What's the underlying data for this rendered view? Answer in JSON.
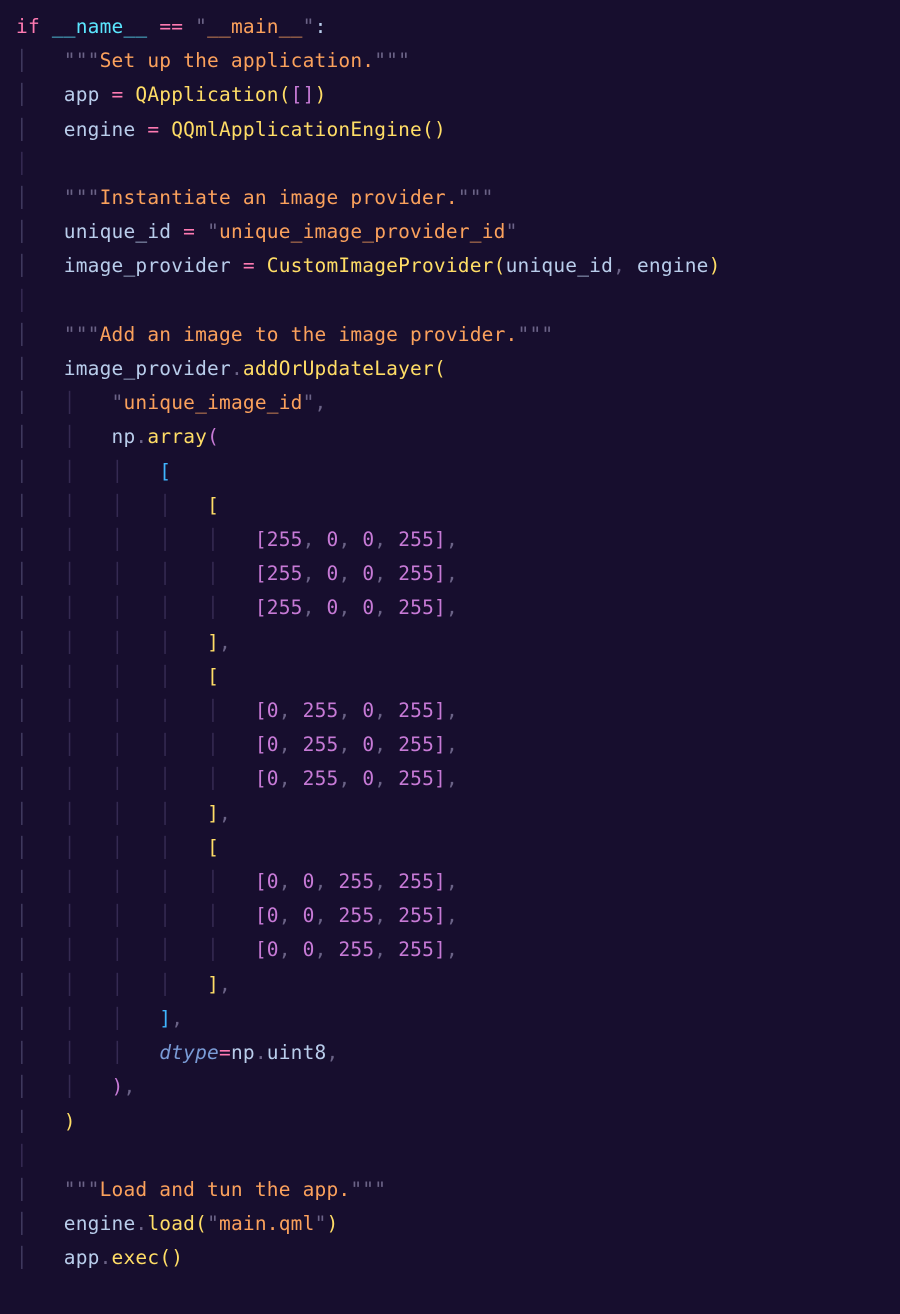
{
  "code": {
    "l1": {
      "if": "if",
      "sp": " ",
      "name": "__name__",
      "eq": " == ",
      "q": "\"",
      "main": "__main__",
      "colon": ":"
    },
    "l2": {
      "q": "\"\"\"",
      "txt": "Set up the application."
    },
    "l3": {
      "app": "app",
      "eq": " = ",
      "fn": "QApplication",
      "lp": "(",
      "lb": "[",
      "rb": "]",
      "rp": ")"
    },
    "l4": {
      "engine": "engine",
      "eq": " = ",
      "fn": "QQmlApplicationEngine",
      "lp": "(",
      "rp": ")"
    },
    "l5": {
      "q": "\"\"\"",
      "txt": "Instantiate an image provider."
    },
    "l6": {
      "uid": "unique_id",
      "eq": " = ",
      "q": "\"",
      "val": "unique_image_provider_id"
    },
    "l7": {
      "ip": "image_provider",
      "eq": " = ",
      "fn": "CustomImageProvider",
      "lp": "(",
      "a1": "unique_id",
      "c": ", ",
      "a2": "engine",
      "rp": ")"
    },
    "l8": {
      "q": "\"\"\"",
      "txt": "Add an image to the image provider."
    },
    "l9": {
      "ip": "image_provider",
      "dot": ".",
      "fn": "addOrUpdateLayer",
      "lp": "("
    },
    "l10": {
      "q": "\"",
      "val": "unique_image_id",
      "c": ","
    },
    "l11": {
      "np": "np",
      "dot": ".",
      "fn": "array",
      "lp": "("
    },
    "l12": {
      "lb": "["
    },
    "l13": {
      "lb": "["
    },
    "row_red": {
      "lb": "[",
      "a": "255",
      "b": "0",
      "c2": "0",
      "d": "255",
      "rb": "]",
      "tc": ","
    },
    "l17": {
      "rb": "]",
      "c": ","
    },
    "l18": {
      "lb": "["
    },
    "row_green": {
      "lb": "[",
      "a": "0",
      "b": "255",
      "c2": "0",
      "d": "255",
      "rb": "]",
      "tc": ","
    },
    "l22": {
      "rb": "]",
      "c": ","
    },
    "l23": {
      "lb": "["
    },
    "row_blue": {
      "lb": "[",
      "a": "0",
      "b": "0",
      "c2": "255",
      "d": "255",
      "rb": "]",
      "tc": ","
    },
    "l27": {
      "rb": "]",
      "c": ","
    },
    "l28": {
      "rb": "]",
      "c": ","
    },
    "l29": {
      "dtype": "dtype",
      "eq": "=",
      "np": "np",
      "dot": ".",
      "u8": "uint8",
      "c": ","
    },
    "l30": {
      "rp": ")",
      "c": ","
    },
    "l31": {
      "rp": ")"
    },
    "l32": {
      "q": "\"\"\"",
      "txt": "Load and tun the app."
    },
    "l33": {
      "engine": "engine",
      "dot": ".",
      "fn": "load",
      "lp": "(",
      "q": "\"",
      "val": "main.qml",
      "rp": ")"
    },
    "l34": {
      "app": "app",
      "dot": ".",
      "fn": "exec",
      "lp": "(",
      "rp": ")"
    }
  }
}
